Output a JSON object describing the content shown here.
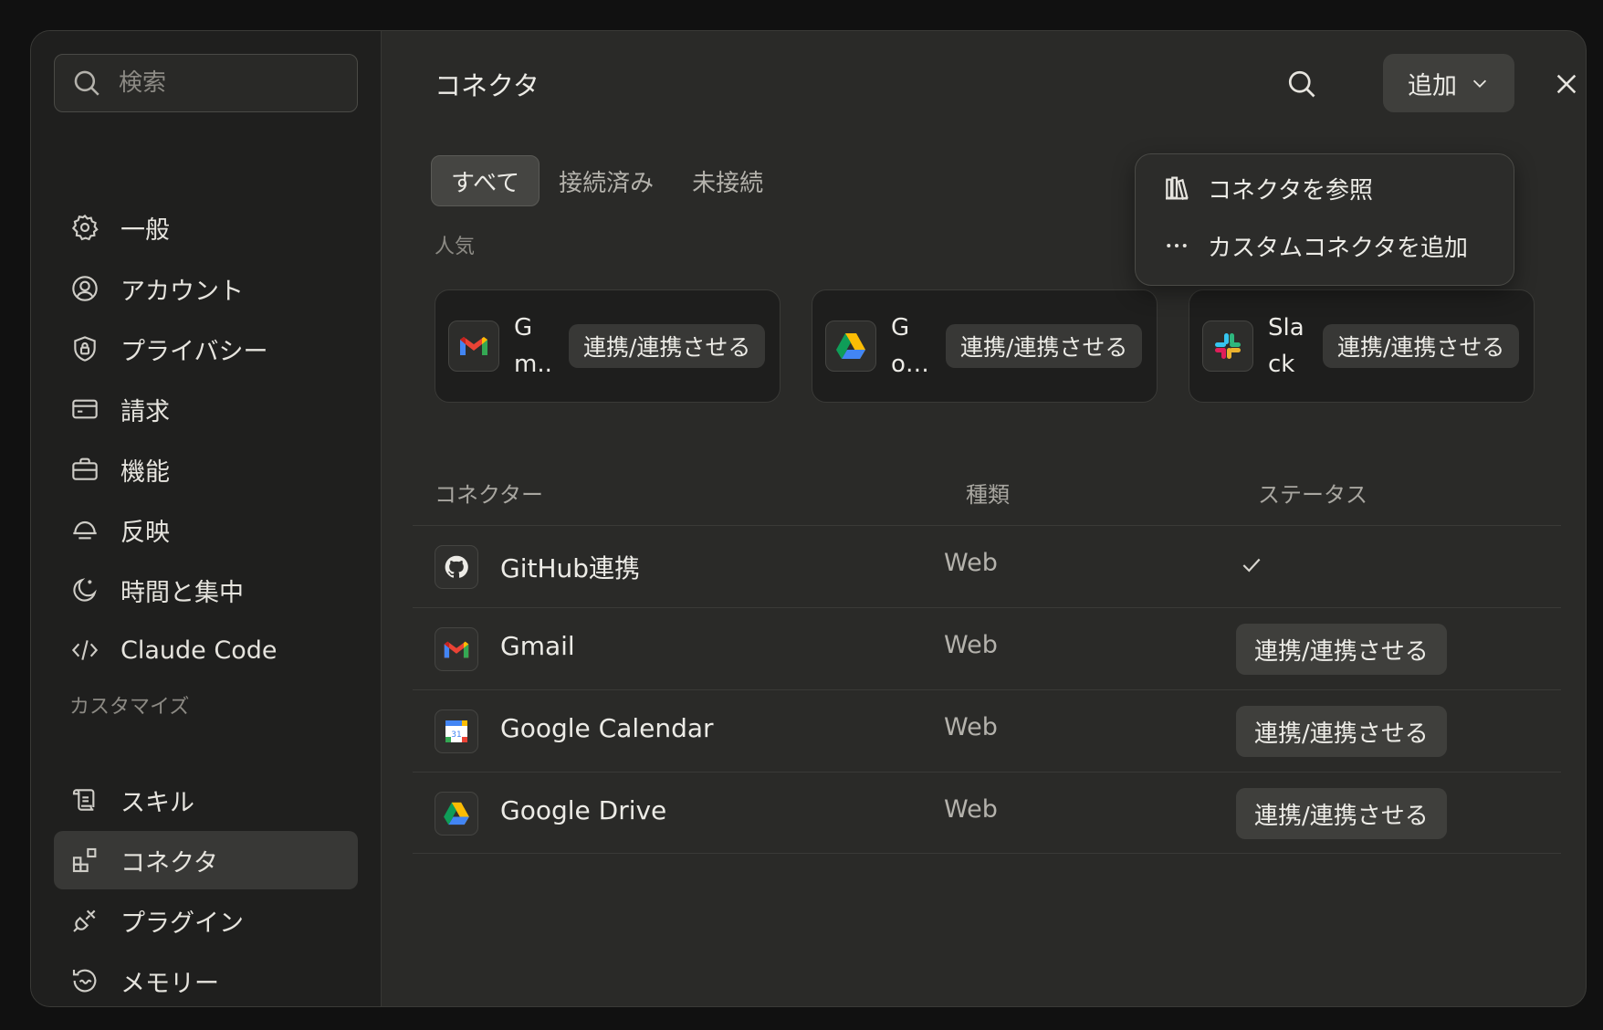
{
  "search": {
    "placeholder": "検索"
  },
  "sidebar": {
    "items": [
      {
        "label": "一般",
        "icon": "gear-icon"
      },
      {
        "label": "アカウント",
        "icon": "user-circle-icon"
      },
      {
        "label": "プライバシー",
        "icon": "shield-lock-icon"
      },
      {
        "label": "請求",
        "icon": "credit-card-icon"
      },
      {
        "label": "機能",
        "icon": "briefcase-icon"
      },
      {
        "label": "反映",
        "icon": "bell-icon"
      },
      {
        "label": "時間と集中",
        "icon": "moon-icon"
      },
      {
        "label": "Claude Code",
        "icon": "code-icon"
      }
    ],
    "section_label": "カスタマイズ",
    "custom_items": [
      {
        "label": "スキル",
        "icon": "scroll-icon"
      },
      {
        "label": "コネクタ",
        "icon": "blocks-icon",
        "active": true
      },
      {
        "label": "プラグイン",
        "icon": "plug-icon"
      },
      {
        "label": "メモリー",
        "icon": "history-icon"
      }
    ]
  },
  "main": {
    "title": "コネクタ",
    "add_label": "追加",
    "tabs": [
      {
        "label": "すべて",
        "active": true
      },
      {
        "label": "接続済み"
      },
      {
        "label": "未接続"
      }
    ],
    "popular_label": "人気",
    "popular_cards": [
      {
        "name": "Gm..",
        "button": "連携/連携させる",
        "icon": "gmail-icon"
      },
      {
        "name": "Go…",
        "button": "連携/連携させる",
        "icon": "google-drive-icon"
      },
      {
        "name": "Slack",
        "button": "連携/連携させる",
        "icon": "slack-icon"
      }
    ],
    "table": {
      "headers": {
        "connector": "コネクター",
        "type": "種類",
        "status": "ステータス"
      },
      "rows": [
        {
          "name": "GitHub連携",
          "type": "Web",
          "status": "",
          "connected": true,
          "icon": "github-icon"
        },
        {
          "name": "Gmail",
          "type": "Web",
          "status": "連携/連携させる",
          "icon": "gmail-icon"
        },
        {
          "name": "Google Calendar",
          "type": "Web",
          "status": "連携/連携させる",
          "icon": "google-calendar-icon"
        },
        {
          "name": "Google Drive",
          "type": "Web",
          "status": "連携/連携させる",
          "icon": "google-drive-icon"
        }
      ]
    }
  },
  "add_menu": {
    "items": [
      {
        "label": "コネクタを参照",
        "icon": "library-icon"
      },
      {
        "label": "カスタムコネクタを追加",
        "icon": "ellipsis-icon"
      }
    ]
  },
  "colors": {
    "background": "#2a2a28",
    "sidebar": "#1f1f1e",
    "button": "#3f3f3c"
  }
}
